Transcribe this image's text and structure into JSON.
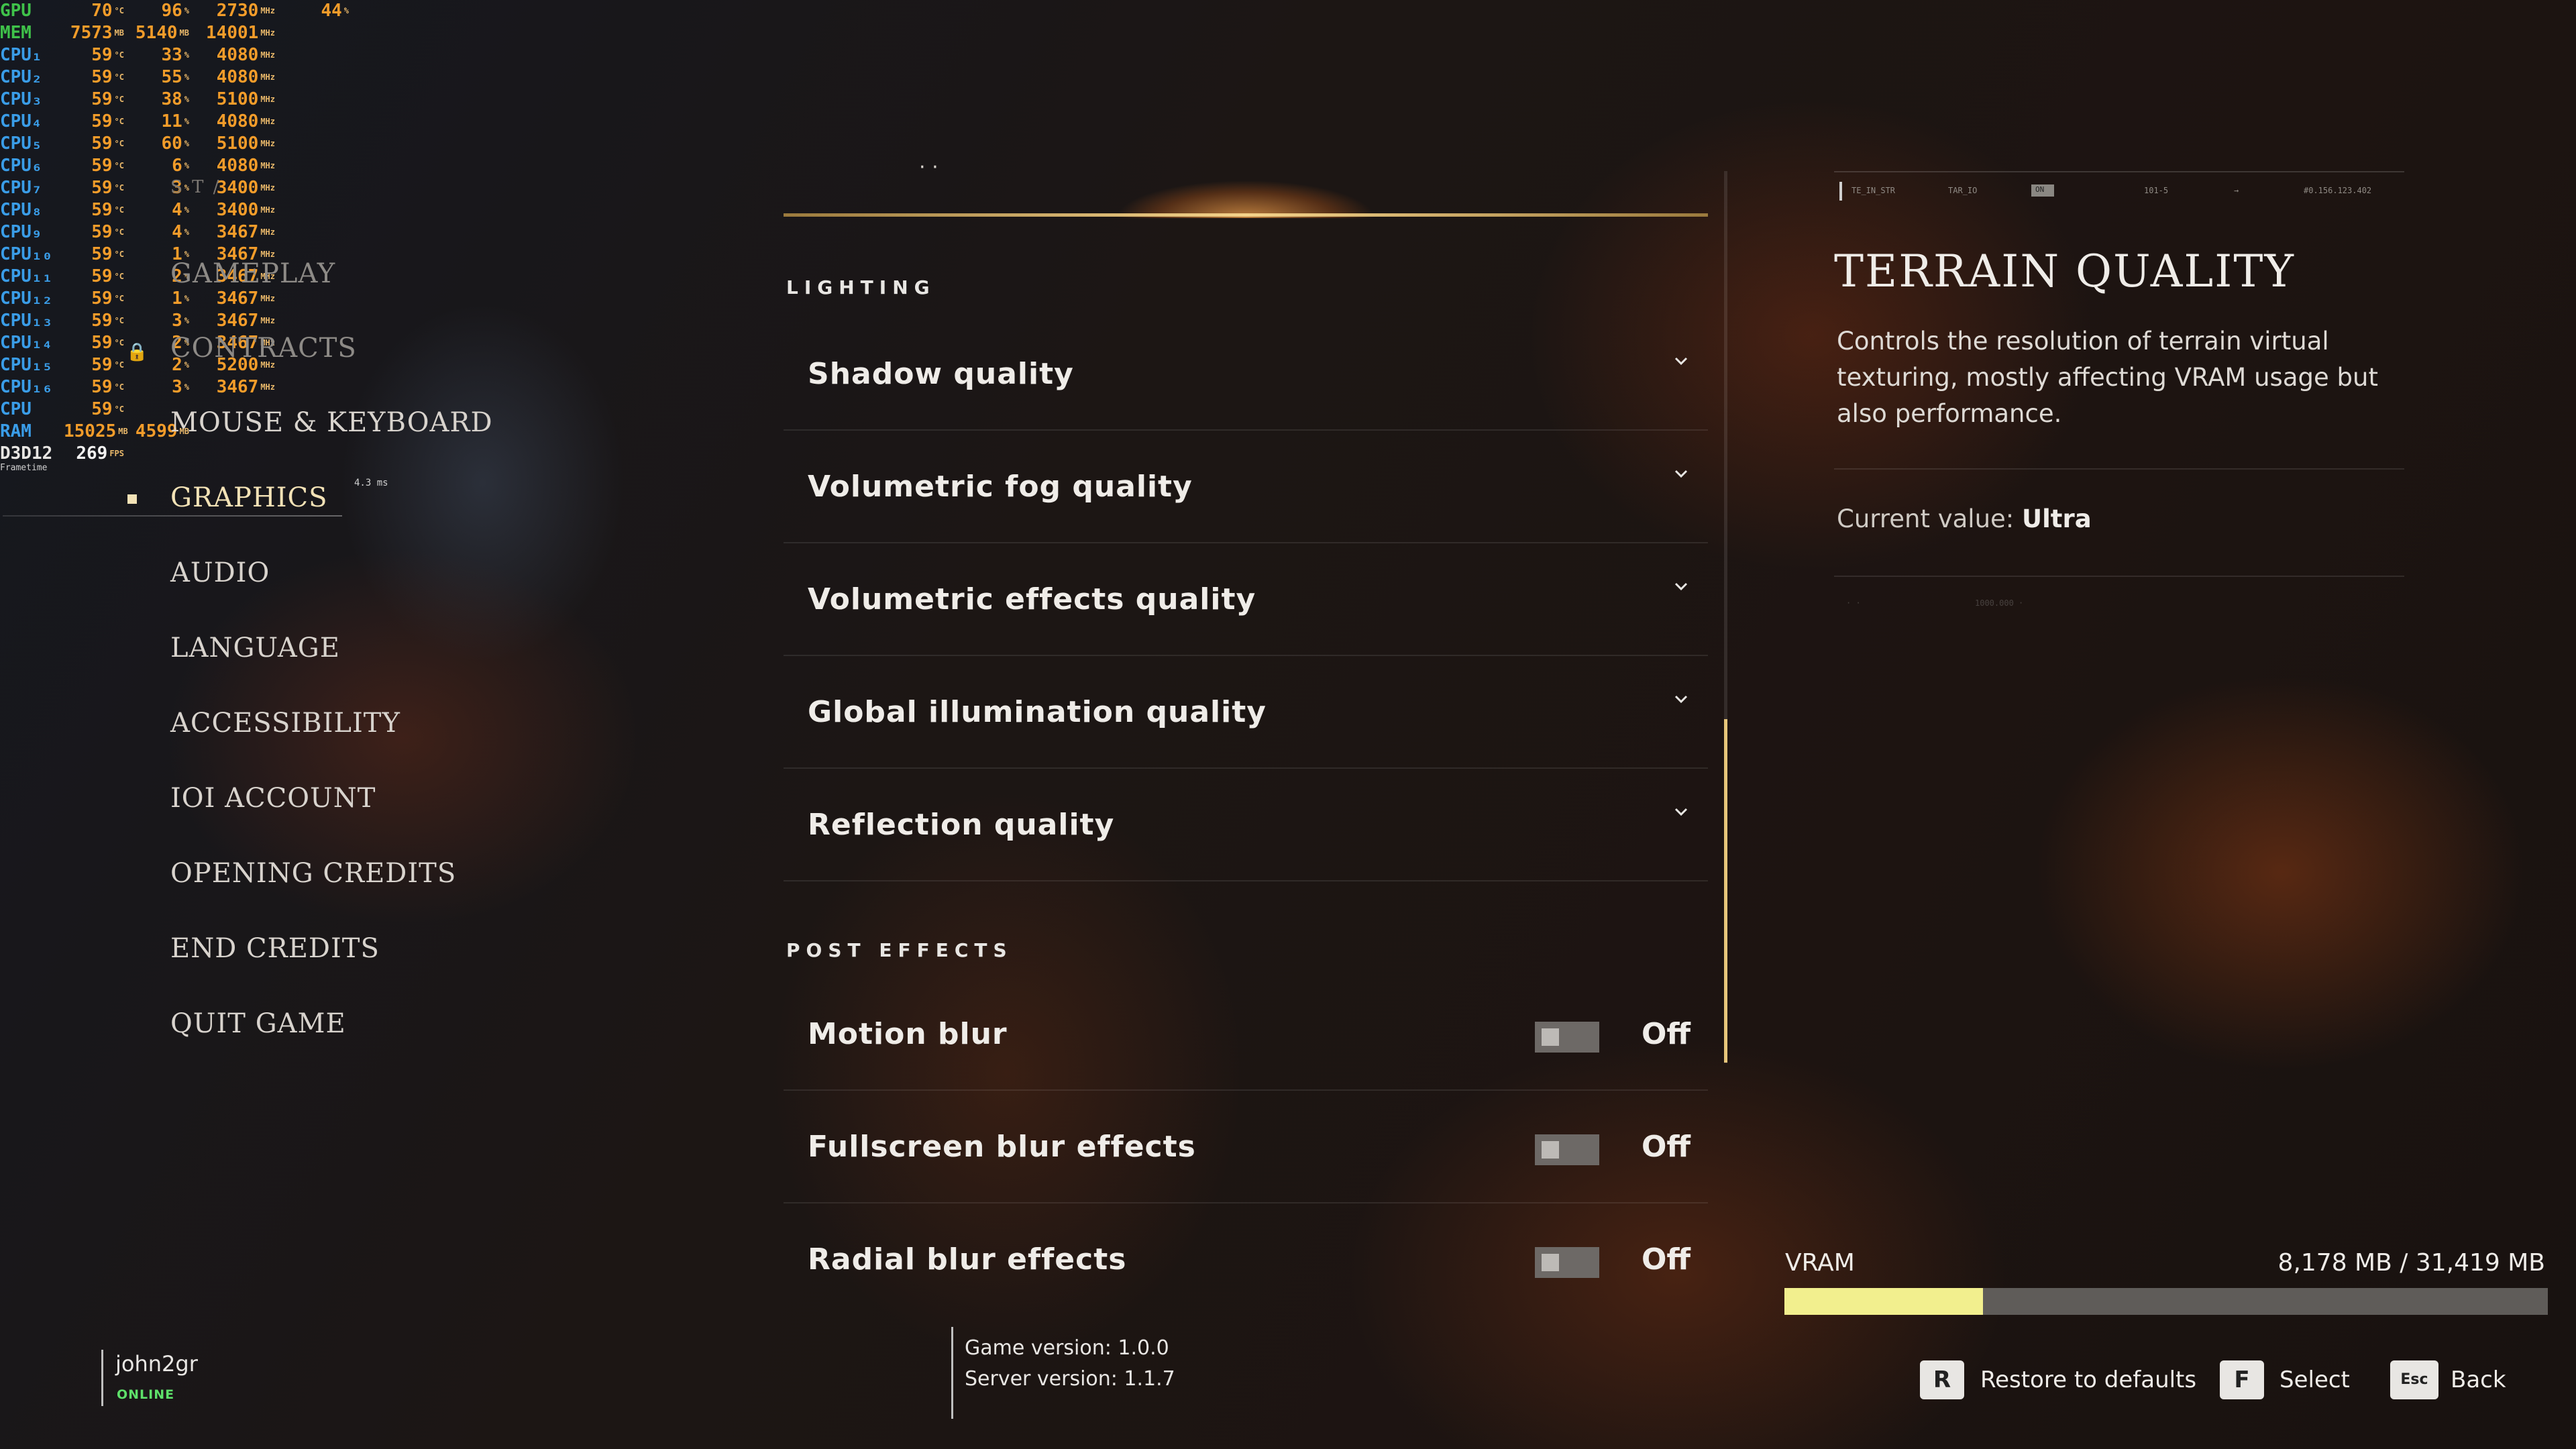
{
  "osd": {
    "rows": [
      {
        "label": "GPU",
        "lc": "green",
        "c1": "70",
        "u1": "°C",
        "c2": "96",
        "u2": "%",
        "c3": "2730",
        "u3": "MHz",
        "c4": "44",
        "u4": "%"
      },
      {
        "label": "MEM",
        "lc": "green",
        "c1": "7573",
        "u1": "MB",
        "c2": "5140",
        "u2": "MB",
        "c3": "14001",
        "u3": "MHz",
        "c4": "",
        "u4": ""
      },
      {
        "label": "CPU₁",
        "lc": "blue",
        "c1": "59",
        "u1": "°C",
        "c2": "33",
        "u2": "%",
        "c3": "4080",
        "u3": "MHz",
        "c4": "",
        "u4": ""
      },
      {
        "label": "CPU₂",
        "lc": "blue",
        "c1": "59",
        "u1": "°C",
        "c2": "55",
        "u2": "%",
        "c3": "4080",
        "u3": "MHz",
        "c4": "",
        "u4": ""
      },
      {
        "label": "CPU₃",
        "lc": "blue",
        "c1": "59",
        "u1": "°C",
        "c2": "38",
        "u2": "%",
        "c3": "5100",
        "u3": "MHz",
        "c4": "",
        "u4": ""
      },
      {
        "label": "CPU₄",
        "lc": "blue",
        "c1": "59",
        "u1": "°C",
        "c2": "11",
        "u2": "%",
        "c3": "4080",
        "u3": "MHz",
        "c4": "",
        "u4": ""
      },
      {
        "label": "CPU₅",
        "lc": "blue",
        "c1": "59",
        "u1": "°C",
        "c2": "60",
        "u2": "%",
        "c3": "5100",
        "u3": "MHz",
        "c4": "",
        "u4": ""
      },
      {
        "label": "CPU₆",
        "lc": "blue",
        "c1": "59",
        "u1": "°C",
        "c2": "6",
        "u2": "%",
        "c3": "4080",
        "u3": "MHz",
        "c4": "",
        "u4": ""
      },
      {
        "label": "CPU₇",
        "lc": "blue",
        "c1": "59",
        "u1": "°C",
        "c2": "3",
        "u2": "%",
        "c3": "3400",
        "u3": "MHz",
        "c4": "",
        "u4": ""
      },
      {
        "label": "CPU₈",
        "lc": "blue",
        "c1": "59",
        "u1": "°C",
        "c2": "4",
        "u2": "%",
        "c3": "3400",
        "u3": "MHz",
        "c4": "",
        "u4": ""
      },
      {
        "label": "CPU₉",
        "lc": "blue",
        "c1": "59",
        "u1": "°C",
        "c2": "4",
        "u2": "%",
        "c3": "3467",
        "u3": "MHz",
        "c4": "",
        "u4": ""
      },
      {
        "label": "CPU₁₀",
        "lc": "blue",
        "c1": "59",
        "u1": "°C",
        "c2": "1",
        "u2": "%",
        "c3": "3467",
        "u3": "MHz",
        "c4": "",
        "u4": ""
      },
      {
        "label": "CPU₁₁",
        "lc": "blue",
        "c1": "59",
        "u1": "°C",
        "c2": "2",
        "u2": "%",
        "c3": "3467",
        "u3": "MHz",
        "c4": "",
        "u4": ""
      },
      {
        "label": "CPU₁₂",
        "lc": "blue",
        "c1": "59",
        "u1": "°C",
        "c2": "1",
        "u2": "%",
        "c3": "3467",
        "u3": "MHz",
        "c4": "",
        "u4": ""
      },
      {
        "label": "CPU₁₃",
        "lc": "blue",
        "c1": "59",
        "u1": "°C",
        "c2": "3",
        "u2": "%",
        "c3": "3467",
        "u3": "MHz",
        "c4": "",
        "u4": ""
      },
      {
        "label": "CPU₁₄",
        "lc": "blue",
        "c1": "59",
        "u1": "°C",
        "c2": "2",
        "u2": "%",
        "c3": "3467",
        "u3": "MHz",
        "c4": "",
        "u4": ""
      },
      {
        "label": "CPU₁₅",
        "lc": "blue",
        "c1": "59",
        "u1": "°C",
        "c2": "2",
        "u2": "%",
        "c3": "5200",
        "u3": "MHz",
        "c4": "",
        "u4": ""
      },
      {
        "label": "CPU₁₆",
        "lc": "blue",
        "c1": "59",
        "u1": "°C",
        "c2": "3",
        "u2": "%",
        "c3": "3467",
        "u3": "MHz",
        "c4": "",
        "u4": ""
      },
      {
        "label": "CPU",
        "lc": "blue",
        "c1": "59",
        "u1": "°C",
        "c2": "",
        "u2": "",
        "c3": "",
        "u3": "",
        "c4": "",
        "u4": ""
      },
      {
        "label": "RAM",
        "lc": "blue",
        "c1": "15025",
        "u1": "MB",
        "c2": "4599",
        "u2": "MB",
        "c3": "",
        "u3": "",
        "c4": "",
        "u4": ""
      },
      {
        "label": "D3D12",
        "lc": "white",
        "c1": "269",
        "u1": "FPS",
        "c2": "",
        "u2": "",
        "c3": "",
        "u3": "",
        "c4": "",
        "u4": ""
      }
    ],
    "frametime_label": "Frametime",
    "frametime_value": "4.3 ms"
  },
  "nav": {
    "faint_path": "S T   /",
    "items": [
      {
        "label": "GAMEPLAY",
        "state": "dim"
      },
      {
        "label": "CONTRACTS",
        "state": "dim"
      },
      {
        "label": "MOUSE & KEYBOARD",
        "state": "normal"
      },
      {
        "label": "GRAPHICS",
        "state": "active"
      },
      {
        "label": "AUDIO",
        "state": "normal"
      },
      {
        "label": "LANGUAGE",
        "state": "normal"
      },
      {
        "label": "ACCESSIBILITY",
        "state": "normal"
      },
      {
        "label": "IOI ACCOUNT",
        "state": "normal"
      },
      {
        "label": "OPENING CREDITS",
        "state": "normal"
      },
      {
        "label": "END CREDITS",
        "state": "normal"
      },
      {
        "label": "QUIT GAME",
        "state": "normal"
      }
    ]
  },
  "user": {
    "name": "john2gr",
    "status": "ONLINE"
  },
  "version": {
    "game": "Game version: 1.0.0",
    "server": "Server version: 1.1.7"
  },
  "settings": {
    "fragment": "·   ·",
    "lighting_header": "LIGHTING",
    "lighting": [
      {
        "label": "Shadow quality"
      },
      {
        "label": "Volumetric fog quality"
      },
      {
        "label": "Volumetric effects quality"
      },
      {
        "label": "Global illumination quality"
      },
      {
        "label": "Reflection quality"
      }
    ],
    "post_header": "POST EFFECTS",
    "post": [
      {
        "label": "Motion blur",
        "value": "Off"
      },
      {
        "label": "Fullscreen blur effects",
        "value": "Off"
      },
      {
        "label": "Radial blur effects",
        "value": "Off"
      }
    ]
  },
  "detail": {
    "tabs": [
      "TE_IN_STR",
      "TAR_IO",
      "101-5",
      "→",
      "#0.156.123.402"
    ],
    "tab_box": "ON",
    "title": "TERRAIN QUALITY",
    "description": "Controls the resolution of terrain virtual texturing, mostly affecting VRAM usage but also performance.",
    "current_label": "Current value:",
    "current_value": "Ultra",
    "ghost_a": "· ·",
    "ghost_b": "1000.000 ·"
  },
  "vram": {
    "label": "VRAM",
    "value": "8,178 MB / 31,419 MB",
    "used_mb": 8178,
    "total_mb": 31419
  },
  "hints": [
    {
      "key": "R",
      "label": "Restore to defaults"
    },
    {
      "key": "F",
      "label": "Select"
    },
    {
      "key": "Esc",
      "label": "Back"
    }
  ],
  "colors": {
    "accent": "#f3e2b6",
    "osd_value": "#f29c2a",
    "osd_blue": "#3a9de8",
    "osd_green": "#3fc24a",
    "vram_fill": "#f2ef8e",
    "online": "#5ee06a"
  }
}
